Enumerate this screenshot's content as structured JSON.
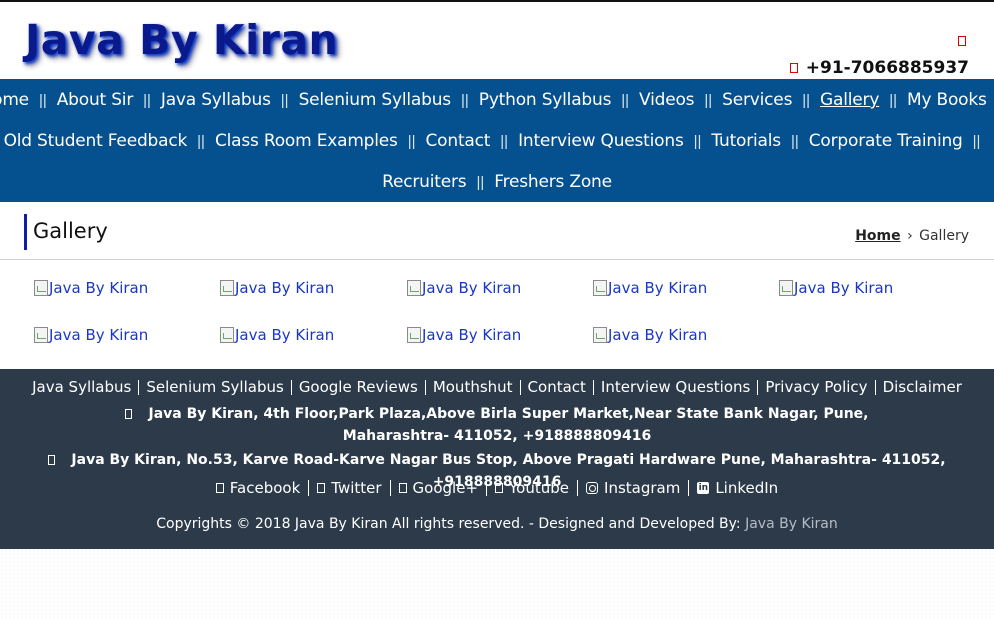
{
  "header": {
    "logo": "Java By Kiran",
    "phone": "+91-7066885937"
  },
  "nav": {
    "rows": [
      [
        "Home",
        "About Sir",
        "Java Syllabus",
        "Selenium Syllabus",
        "Python Syllabus",
        "Videos",
        "Services",
        "Gallery",
        "My Books"
      ],
      [
        "Old Student Feedback",
        "Class Room Examples",
        "Contact",
        "Interview Questions",
        "Tutorials",
        "Corporate Training"
      ],
      [
        "Recruiters",
        "Freshers Zone"
      ]
    ],
    "active": "Gallery"
  },
  "page": {
    "title": "Gallery",
    "breadcrumb": {
      "home": "Home",
      "separator": "›",
      "current": "Gallery"
    }
  },
  "gallery": {
    "items": [
      "Java By Kiran",
      "Java By Kiran",
      "Java By Kiran",
      "Java By Kiran",
      "Java By Kiran",
      "Java By Kiran",
      "Java By Kiran",
      "Java By Kiran",
      "Java By Kiran"
    ]
  },
  "footer": {
    "links": [
      "Java Syllabus",
      "Selenium Syllabus",
      "Google Reviews",
      "Mouthshut",
      "Contact",
      "Interview Questions",
      "Privacy Policy",
      "Disclaimer"
    ],
    "addresses": [
      "Java By Kiran, 4th Floor,Park Plaza,Above Birla Super Market,Near State Bank Nagar, Pune, Maharashtra- 411052, +918888809416",
      "Java By Kiran, No.53, Karve Road-Karve Nagar Bus Stop, Above Pragati Hardware Pune, Maharashtra- 411052, +918888809416"
    ],
    "social": [
      {
        "label": "Facebook",
        "icon": "facebook-icon"
      },
      {
        "label": "Twitter",
        "icon": "twitter-icon"
      },
      {
        "label": "Google+",
        "icon": "google-plus-icon"
      },
      {
        "label": "Youtube",
        "icon": "youtube-icon"
      },
      {
        "label": "Instagram",
        "icon": "instagram-icon"
      },
      {
        "label": "LinkedIn",
        "icon": "linkedin-icon"
      }
    ],
    "copyright": {
      "text": "Copyrights © 2018 Java By Kiran All rights reserved. - Designed and Developed By:",
      "link": "Java By Kiran"
    }
  },
  "colors": {
    "nav_bg": "#05508e",
    "footer_bg": "#2c3a4a",
    "logo": "#0a1a8c",
    "accent_bar": "#0b1fa0",
    "gallery_link": "#1a37c7"
  }
}
